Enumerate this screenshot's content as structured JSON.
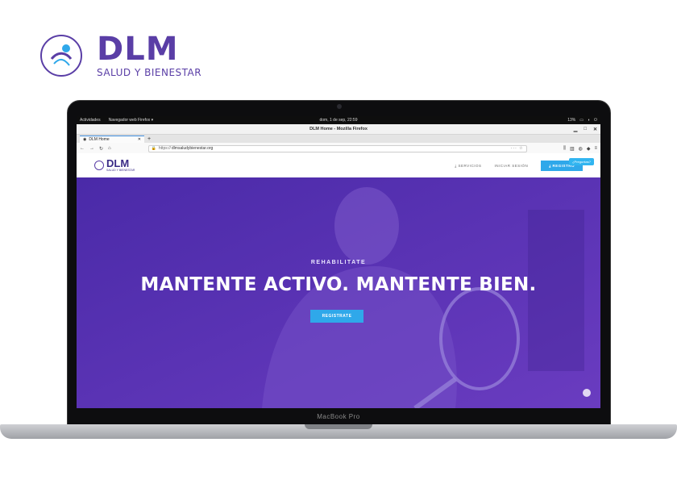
{
  "brand": {
    "name": "DLM",
    "tagline": "SALUD Y BIENESTAR"
  },
  "laptop": {
    "model": "MacBook Pro"
  },
  "os_bar": {
    "activities": "Actividades",
    "app": "Navegador web Firefox ▾",
    "clock": "dom, 1 de sep, 22:59",
    "battery": "13%"
  },
  "browser": {
    "window_title": "DLM Home - Mozilla Firefox",
    "tab_label": "DLM Home",
    "url_prefix": "https://",
    "url_host": "dlmsaludybienestar.org"
  },
  "site": {
    "logo_text": "DLM",
    "logo_sub": "SALUD Y BIENESTAR",
    "nav": {
      "servicios": "SERVICIOS",
      "login": "INICIAR SESIÓN",
      "register": "REGISTRO"
    },
    "tooltip": "¿Preguntas?",
    "hero": {
      "kicker": "REHABILITATE",
      "title": "MANTENTE ACTIVO. MANTENTE BIEN.",
      "cta": "REGISTRATE"
    }
  },
  "colors": {
    "brand_purple": "#5a3ea6",
    "hero_purple": "#5a32b8",
    "accent_blue": "#2fa8ea"
  }
}
